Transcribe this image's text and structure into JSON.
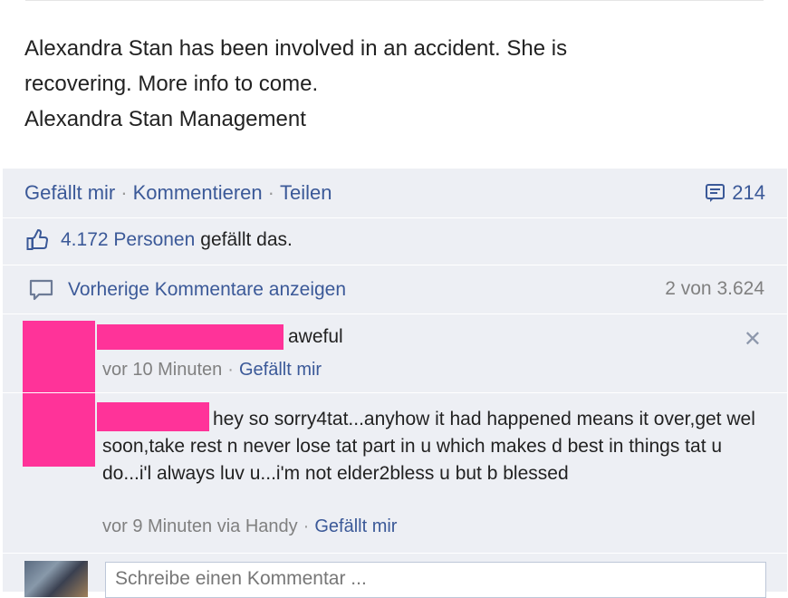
{
  "post": {
    "lines": [
      "Alexandra Stan has been involved in an accident. She is",
      "recovering. More info to come.",
      "Alexandra Stan Management"
    ]
  },
  "actions": {
    "like": "Gefällt mir",
    "comment": "Kommentieren",
    "share": "Teilen",
    "separator": "·",
    "comment_count": "214"
  },
  "likes": {
    "count_link": "4.172 Personen",
    "suffix": "gefällt das."
  },
  "previous_comments": {
    "label": "Vorherige Kommentare anzeigen",
    "count": "2 von 3.624"
  },
  "comments": [
    {
      "text": "aweful",
      "time": "vor 10 Minuten",
      "like": "Gefällt mir"
    },
    {
      "text": "hey so sorry4tat...anyhow it had happened means it over,get wel soon,take rest n never lose tat part in u which makes d best in things tat u do...i'l always luv u...i'm not elder2bless u but b blessed",
      "time": "vor 9 Minuten via Handy",
      "like": "Gefällt mir"
    }
  ],
  "compose": {
    "placeholder": "Schreibe einen Kommentar ..."
  },
  "colors": {
    "link": "#3b5998",
    "panel": "#edeff4",
    "redaction": "#ff3399"
  },
  "icons": {
    "comment_count": "comment-count-icon",
    "like": "thumbs-up-icon",
    "previous": "speech-bubble-icon",
    "close": "close-icon"
  }
}
